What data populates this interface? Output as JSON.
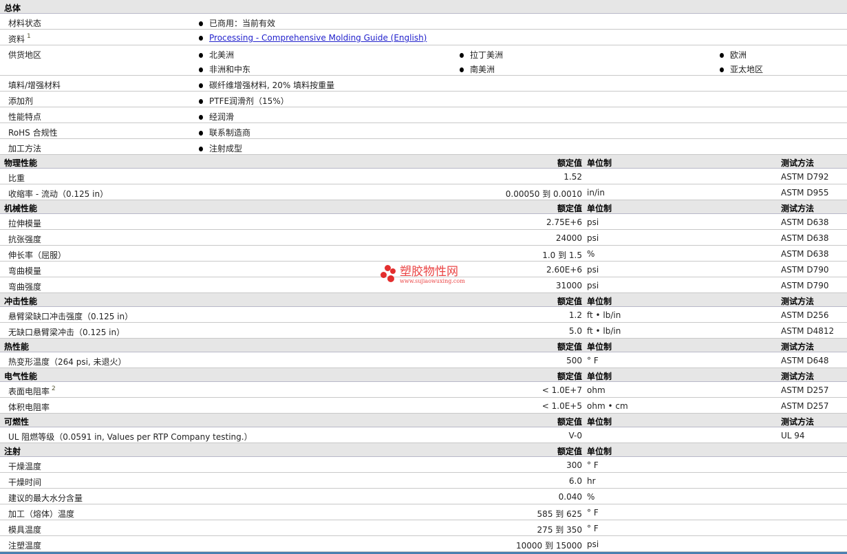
{
  "sections": [
    {
      "title": "总体",
      "kind": "general",
      "rows": [
        {
          "label": "材料状态",
          "values": [
            "已商用：当前有效"
          ]
        },
        {
          "label": "资料",
          "sup": "1",
          "values": [
            "Processing - Comprehensive Molding Guide (English)"
          ],
          "link": true
        },
        {
          "label": "供货地区",
          "regions": [
            "北美洲",
            "拉丁美洲",
            "欧洲",
            "非洲和中东",
            "南美洲",
            "亚太地区"
          ]
        },
        {
          "label": "填料/增强材料",
          "values": [
            "碳纤维增强材料, 20% 填料按重量"
          ]
        },
        {
          "label": "添加剂",
          "values": [
            "PTFE润滑剂（15%）"
          ]
        },
        {
          "label": "性能特点",
          "values": [
            "经润滑"
          ]
        },
        {
          "label": "RoHS 合规性",
          "values": [
            "联系制造商"
          ]
        },
        {
          "label": "加工方法",
          "values": [
            "注射成型"
          ]
        }
      ]
    },
    {
      "title": "物理性能",
      "value_header": "额定值",
      "unit_header": "单位制",
      "test_header": "测试方法",
      "rows": [
        {
          "label": "比重",
          "value": "1.52",
          "unit": "",
          "test": "ASTM D792"
        },
        {
          "label": "收缩率 - 流动（0.125 in）",
          "value": "0.00050 到 0.0010",
          "unit": "in/in",
          "test": "ASTM D955"
        }
      ]
    },
    {
      "title": "机械性能",
      "value_header": "额定值",
      "unit_header": "单位制",
      "test_header": "测试方法",
      "rows": [
        {
          "label": "拉伸模量",
          "value": "2.75E+6",
          "unit": "psi",
          "test": "ASTM D638"
        },
        {
          "label": "抗张强度",
          "value": "24000",
          "unit": "psi",
          "test": "ASTM D638"
        },
        {
          "label": "伸长率（屈服）",
          "value": "1.0 到 1.5",
          "unit": "%",
          "test": "ASTM D638"
        },
        {
          "label": "弯曲模量",
          "value": "2.60E+6",
          "unit": "psi",
          "test": "ASTM D790"
        },
        {
          "label": "弯曲强度",
          "value": "31000",
          "unit": "psi",
          "test": "ASTM D790"
        }
      ]
    },
    {
      "title": "冲击性能",
      "value_header": "额定值",
      "unit_header": "单位制",
      "test_header": "测试方法",
      "rows": [
        {
          "label": "悬臂梁缺口冲击强度（0.125 in）",
          "value": "1.2",
          "unit": "ft • lb/in",
          "test": "ASTM D256"
        },
        {
          "label": "无缺口悬臂梁冲击（0.125 in）",
          "value": "5.0",
          "unit": "ft • lb/in",
          "test": "ASTM D4812"
        }
      ]
    },
    {
      "title": "热性能",
      "value_header": "额定值",
      "unit_header": "单位制",
      "test_header": "测试方法",
      "rows": [
        {
          "label": "热变形温度（264 psi, 未退火）",
          "value": "500",
          "unit": "° F",
          "test": "ASTM D648"
        }
      ]
    },
    {
      "title": "电气性能",
      "value_header": "额定值",
      "unit_header": "单位制",
      "test_header": "测试方法",
      "rows": [
        {
          "label": "表面电阻率",
          "sup": "2",
          "value": "< 1.0E+7",
          "unit": "ohm",
          "test": "ASTM D257"
        },
        {
          "label": "体积电阻率",
          "value": "< 1.0E+5",
          "unit": "ohm • cm",
          "test": "ASTM D257"
        }
      ]
    },
    {
      "title": "可燃性",
      "value_header": "额定值",
      "unit_header": "单位制",
      "test_header": "测试方法",
      "rows": [
        {
          "label": "UL 阻燃等级（0.0591 in, Values per RTP Company testing.）",
          "value": "V-0",
          "unit": "",
          "test": "UL 94"
        }
      ]
    },
    {
      "title": "注射",
      "value_header": "额定值",
      "unit_header": "单位制",
      "rows": [
        {
          "label": "干燥温度",
          "value": "300",
          "unit": "° F"
        },
        {
          "label": "干燥时间",
          "value": "6.0",
          "unit": "hr"
        },
        {
          "label": "建议的最大水分含量",
          "value": "0.040",
          "unit": "%"
        },
        {
          "label": "加工（熔体）温度",
          "value": "585 到 625",
          "unit": "° F"
        },
        {
          "label": "模具温度",
          "value": "275 到 350",
          "unit": "° F"
        },
        {
          "label": "注塑温度",
          "value": "10000 到 15000",
          "unit": "psi"
        }
      ]
    }
  ],
  "watermark": {
    "title": "塑胶物性网",
    "url": "www.sujiaowuxing.com"
  },
  "colors": {
    "header_bg": "#e6e6e6",
    "link": "#2222cc",
    "watermark": "#e01818"
  }
}
